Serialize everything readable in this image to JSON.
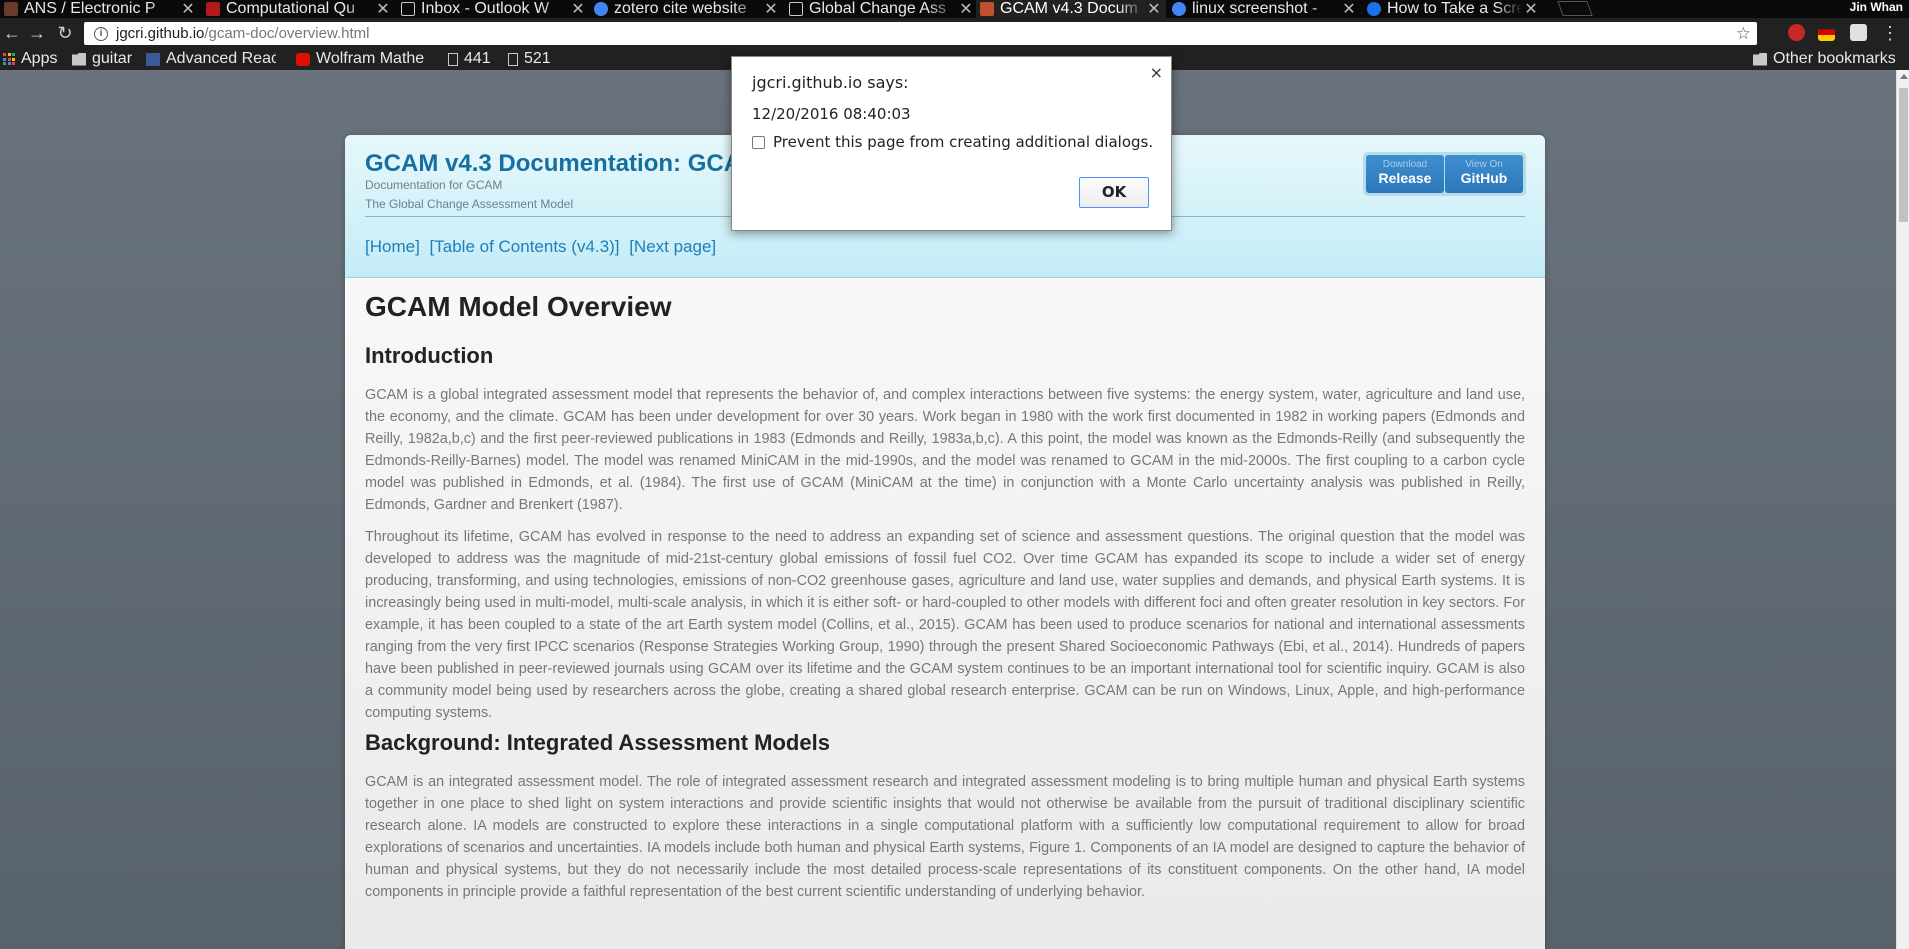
{
  "browser": {
    "tabs": [
      {
        "title": "ANS / Electronic P",
        "favicon_color": "#6a3b2a"
      },
      {
        "title": "Computational Qu",
        "favicon_color": "#b31b1b"
      },
      {
        "title": "Inbox - Outlook W",
        "favicon_color": "#cccccc"
      },
      {
        "title": "zotero cite website",
        "favicon_color": "#4285f4"
      },
      {
        "title": "Global Change Ass",
        "favicon_color": "#cccccc"
      },
      {
        "title": "GCAM v4.3 Docum",
        "favicon_color": "#c2502c"
      },
      {
        "title": "linux screenshot -",
        "favicon_color": "#4285f4"
      },
      {
        "title": "How to Take a Scre",
        "favicon_color": "#1a73e8"
      }
    ],
    "active_tab_index": 5,
    "profile_name": "Jin Whan",
    "url_host": "jgcri.github.io",
    "url_path": "/gcam-doc/overview.html",
    "bookmarks": [
      {
        "label": "Apps",
        "icon": "apps-grid-icon"
      },
      {
        "label": "guitar",
        "icon": "folder-icon"
      },
      {
        "label": "Advanced React",
        "icon": "bookmark-favicon-icon"
      },
      {
        "label": "Wolfram Mathe",
        "icon": "wolfram-icon"
      },
      {
        "label": "441",
        "icon": "page-icon"
      },
      {
        "label": "521",
        "icon": "page-icon"
      }
    ],
    "other_bookmarks": "Other bookmarks"
  },
  "page": {
    "site_title": "GCAM v4.3 Documentation: GCAM",
    "site_subtitle1": "Documentation for GCAM",
    "site_subtitle2": "The Global Change Assessment Model",
    "buttons": {
      "release_small": "Download",
      "release_big": "Release",
      "github_small": "View On",
      "github_big": "GitHub"
    },
    "nav": {
      "home": "[Home]",
      "toc": "[Table of Contents (v4.3)]",
      "next": "[Next page]"
    },
    "heading": "GCAM Model Overview",
    "section1_title": "Introduction",
    "para1": "GCAM is a global integrated assessment model that represents the behavior of, and complex interactions between five systems: the energy system, water, agriculture and land use, the economy, and the climate. GCAM has been under development for over 30 years. Work began in 1980 with the work first documented in 1982 in working papers (Edmonds and Reilly, 1982a,b,c) and the first peer-reviewed publications in 1983 (Edmonds and Reilly, 1983a,b,c). A this point, the model was known as the Edmonds-Reilly (and subsequently the Edmonds-Reilly-Barnes) model. The model was renamed MiniCAM in the mid-1990s, and the model was renamed to GCAM in the mid-2000s. The first coupling to a carbon cycle model was published in Edmonds, et al. (1984). The first use of GCAM (MiniCAM at the time) in conjunction with a Monte Carlo uncertainty analysis was published in Reilly, Edmonds, Gardner and Brenkert (1987).",
    "para2": "Throughout its lifetime, GCAM has evolved in response to the need to address an expanding set of science and assessment questions. The original question that the model was developed to address was the magnitude of mid-21st-century global emissions of fossil fuel CO2. Over time GCAM has expanded its scope to include a wider set of energy producing, transforming, and using technologies, emissions of non-CO2 greenhouse gases, agriculture and land use, water supplies and demands, and physical Earth systems. It is increasingly being used in multi-model, multi-scale analysis, in which it is either soft- or hard-coupled to other models with different foci and often greater resolution in key sectors. For example, it has been coupled to a state of the art Earth system model (Collins, et al., 2015). GCAM has been used to produce scenarios for national and international assessments ranging from the very first IPCC scenarios (Response Strategies Working Group, 1990) through the present Shared Socioeconomic Pathways (Ebi, et al., 2014). Hundreds of papers have been published in peer-reviewed journals using GCAM over its lifetime and the GCAM system continues to be an important international tool for scientific inquiry. GCAM is also a community model being used by researchers across the globe, creating a shared global research enterprise. GCAM can be run on Windows, Linux, Apple, and high-performance computing systems.",
    "section2_title": "Background: Integrated Assessment Models",
    "para3": "GCAM is an integrated assessment model. The role of integrated assessment research and integrated assessment modeling is to bring multiple human and physical Earth systems together in one place to shed light on system interactions and provide scientific insights that would not otherwise be available from the pursuit of traditional disciplinary scientific research alone. IA models are constructed to explore these interactions in a single computational platform with a sufficiently low computational requirement to allow for broad explorations of scenarios and uncertainties. IA models include both human and physical Earth systems, Figure 1. Components of an IA model are designed to capture the behavior of human and physical systems, but they do not necessarily include the most detailed process-scale representations of its constituent components. On the other hand, IA model components in principle provide a faithful representation of the best current scientific understanding of underlying behavior."
  },
  "dialog": {
    "title": "jgcri.github.io says:",
    "message": "12/20/2016 08:40:03",
    "checkbox_label": "Prevent this page from creating additional dialogs.",
    "ok_label": "OK",
    "close_glyph": "×"
  },
  "colors": {
    "accent": "#176fa0",
    "link": "#1e7fb8",
    "button": "#2c78ba"
  }
}
